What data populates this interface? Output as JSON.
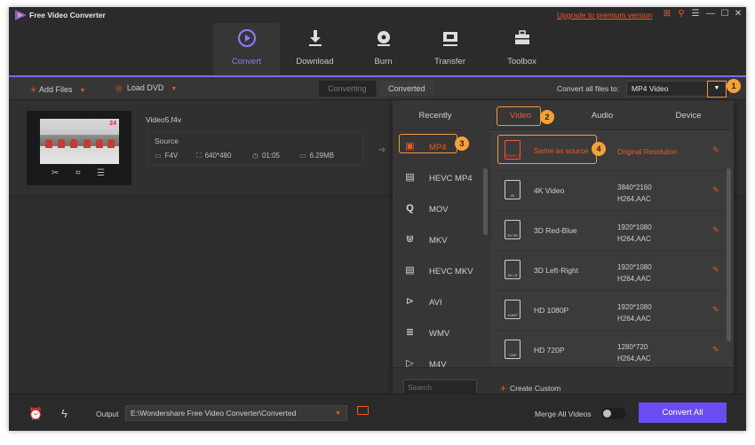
{
  "app": {
    "title": "Free Video Converter",
    "upgrade": "Upgrade to premium version"
  },
  "window_controls": [
    "gift-icon",
    "key-icon",
    "menu-icon",
    "minimize-icon",
    "maximize-icon",
    "close-icon"
  ],
  "nav": {
    "items": [
      {
        "label": "Convert",
        "icon": "convert-icon",
        "active": true
      },
      {
        "label": "Download",
        "icon": "download-icon",
        "active": false
      },
      {
        "label": "Burn",
        "icon": "burn-icon",
        "active": false
      },
      {
        "label": "Transfer",
        "icon": "transfer-icon",
        "active": false
      },
      {
        "label": "Toolbox",
        "icon": "toolbox-icon",
        "active": false
      }
    ],
    "accent": "#8166f2"
  },
  "toolbar": {
    "add_files": "Add Files",
    "load_dvd": "Load DVD",
    "tab_converting": "Converting",
    "tab_converted": "Converted",
    "convert_all_label": "Convert all files to:",
    "format_value": "MP4 Video"
  },
  "file": {
    "name": "Video5.f4v",
    "source_label": "Source",
    "format": "F4V",
    "resolution": "640*480",
    "duration": "01:05",
    "size": "6.29MB"
  },
  "panel": {
    "tabs": [
      "Recently",
      "Video",
      "Audio",
      "Device"
    ],
    "selected_tab": "Video",
    "formats": [
      {
        "label": "MP4",
        "icon": "mp4-icon"
      },
      {
        "label": "HEVC MP4",
        "icon": "hevc-mp4-icon"
      },
      {
        "label": "MOV",
        "icon": "mov-icon"
      },
      {
        "label": "MKV",
        "icon": "mkv-icon"
      },
      {
        "label": "HEVC MKV",
        "icon": "hevc-mkv-icon"
      },
      {
        "label": "AVI",
        "icon": "avi-icon"
      },
      {
        "label": "WMV",
        "icon": "wmv-icon"
      },
      {
        "label": "M4V",
        "icon": "m4v-icon"
      }
    ],
    "presets": [
      {
        "name": "Same as source",
        "tag": "SOURCE",
        "res_line1": "Original Resolution",
        "res_line2": ""
      },
      {
        "name": "4K Video",
        "tag": "4K",
        "res_line1": "3840*2160",
        "res_line2": "H264,AAC"
      },
      {
        "name": "3D Red-Blue",
        "tag": "3D RB",
        "res_line1": "1920*1080",
        "res_line2": "H264,AAC"
      },
      {
        "name": "3D Left-Right",
        "tag": "3D LR",
        "res_line1": "1920*1080",
        "res_line2": "H264,AAC"
      },
      {
        "name": "HD 1080P",
        "tag": "1080P",
        "res_line1": "1920*1080",
        "res_line2": "H264,AAC"
      },
      {
        "name": "HD 720P",
        "tag": "720P",
        "res_line1": "1280*720",
        "res_line2": "H264,AAC"
      }
    ],
    "search_placeholder": "Search",
    "create_custom": "Create Custom"
  },
  "callouts": [
    "1",
    "2",
    "3",
    "4"
  ],
  "footer": {
    "output_label": "Output",
    "output_path": "E:\\Wondershare Free Video Converter\\Converted",
    "merge_label": "Merge All Videos",
    "merge_on": false,
    "convert_all": "Convert All"
  },
  "colors": {
    "accent_orange": "#f05a22",
    "callout": "#f4a13a",
    "primary_button": "#6a4cf0"
  }
}
